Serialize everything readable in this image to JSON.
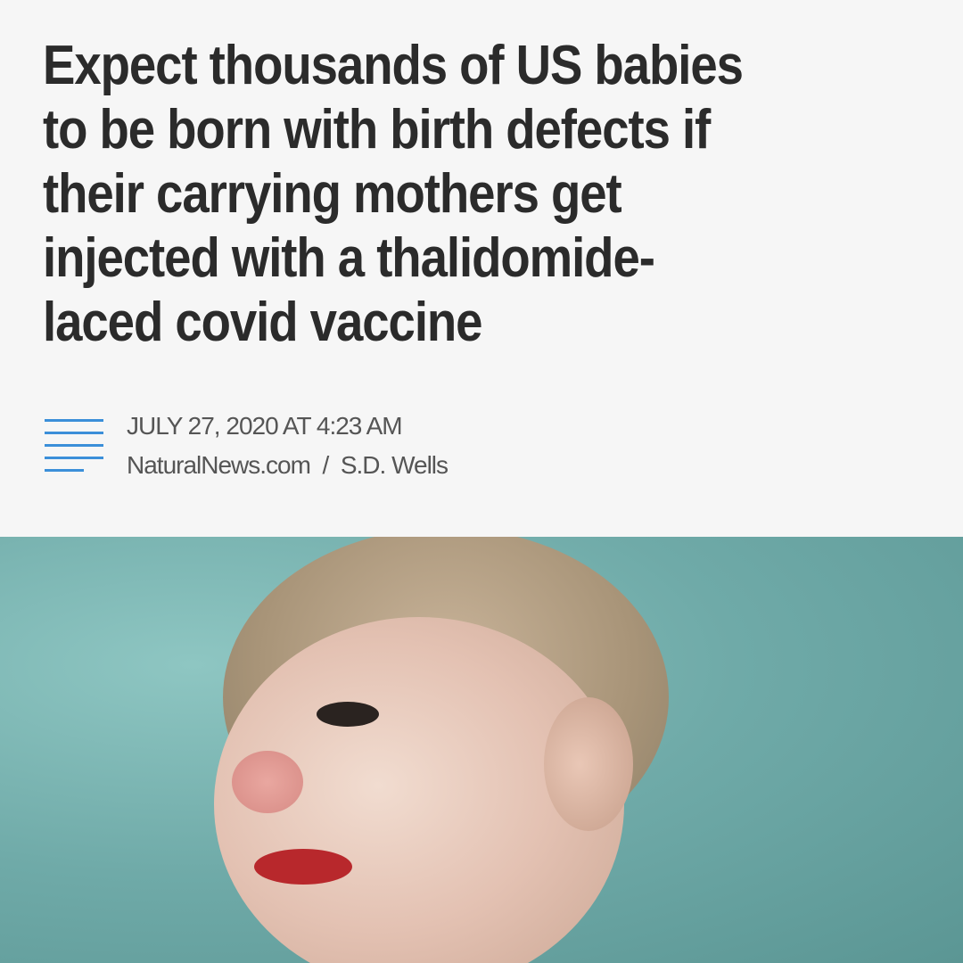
{
  "article": {
    "headline_lines": [
      "Expect thousands of US babies",
      "to be born with birth defects if",
      "their carrying mothers get",
      "injected with a thalidomide-",
      "laced covid vaccine"
    ],
    "date": "JULY 27, 2020 AT 4:23 AM",
    "byline": "NaturalNews.com  /  S.D. Wells",
    "menu_icon": "hamburger-lines-icon",
    "accent_color": "#3b8fd9"
  }
}
